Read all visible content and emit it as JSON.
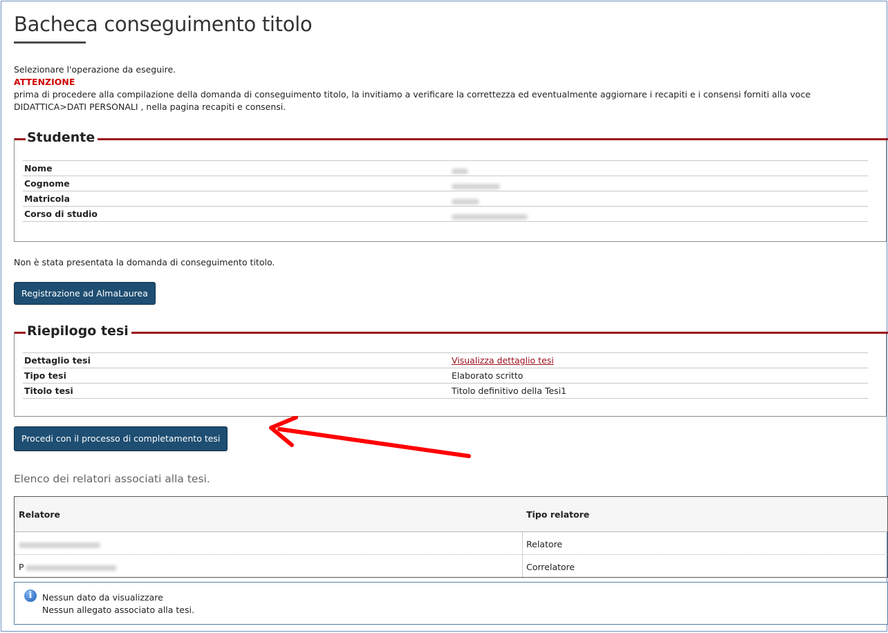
{
  "page": {
    "title": "Bacheca conseguimento titolo"
  },
  "intro": {
    "select_text": "Selezionare l'operazione da eseguire.",
    "warning_label": "ATTENZIONE",
    "warning_text": "prima di procedere alla compilazione della domanda di conseguimento titolo, la invitiamo a verificare la correttezza ed eventualmente aggiornare i recapiti e i consensi forniti alla voce DIDATTICA>DATI PERSONALI , nella pagina recapiti e consensi."
  },
  "studente": {
    "legend": "Studente",
    "rows": [
      {
        "label": "Nome",
        "value_redacted": true
      },
      {
        "label": "Cognome",
        "value_redacted": true
      },
      {
        "label": "Matricola",
        "value_redacted": true
      },
      {
        "label": "Corso di studio",
        "value_redacted": true
      }
    ]
  },
  "status_message": "Non è stata presentata la domanda di conseguimento titolo.",
  "buttons": {
    "almalaurea": "Registrazione ad AlmaLaurea",
    "procedi": "Procedi con il processo di completamento tesi"
  },
  "riepilogo": {
    "legend": "Riepilogo tesi",
    "rows": [
      {
        "label": "Dettaglio tesi",
        "value": "Visualizza dettaglio tesi"
      },
      {
        "label": "Tipo tesi",
        "value": "Elaborato scritto"
      },
      {
        "label": "Titolo tesi",
        "value": "Titolo definitivo della Tesi1"
      }
    ]
  },
  "relatori": {
    "subtitle": "Elenco dei relatori associati alla tesi.",
    "headers": [
      "Relatore",
      "Tipo relatore"
    ],
    "rows": [
      {
        "name_prefix": "",
        "type": "Relatore"
      },
      {
        "name_prefix": "P",
        "type": "Correlatore"
      }
    ]
  },
  "info": {
    "line1": "Nessun dato da visualizzare",
    "line2": "Nessun allegato associato alla tesi."
  },
  "colors": {
    "accent": "#9b0d1a",
    "button": "#1e4e72",
    "warning": "#d00000",
    "annotation_arrow": "#ff0000"
  }
}
